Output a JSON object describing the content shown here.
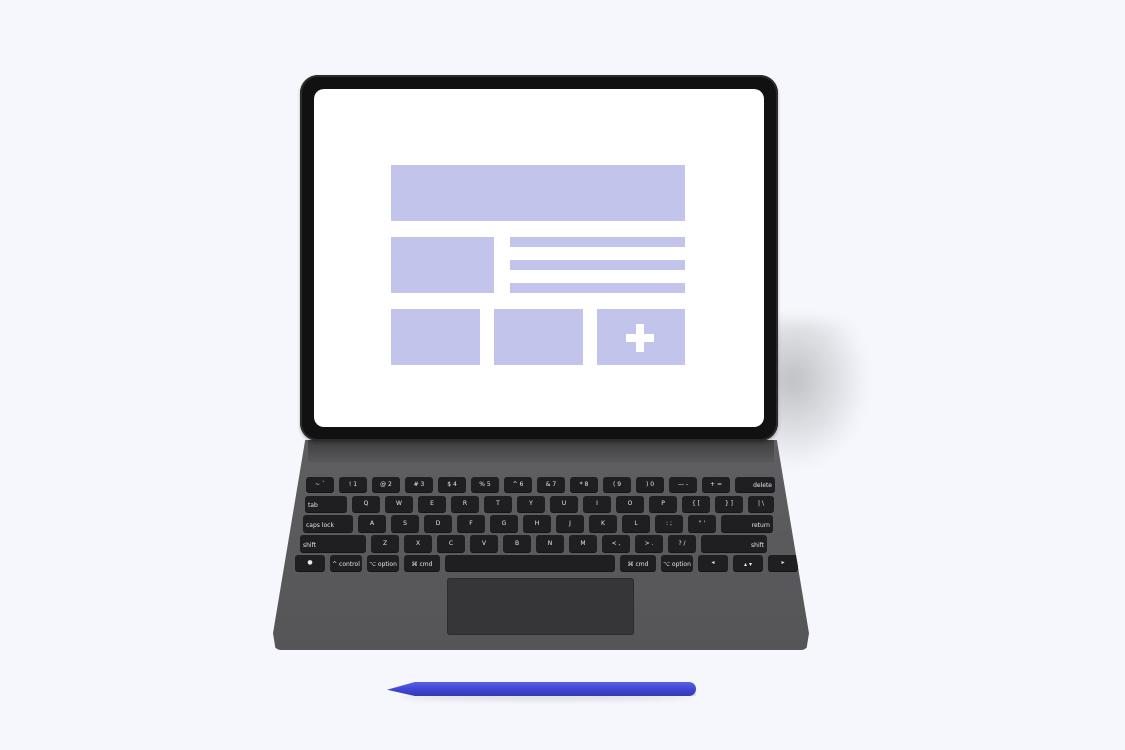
{
  "colors": {
    "background": "#f6f7fc",
    "wireframe": "#c3c4ec",
    "pencil": "#3f45d0",
    "keyboard": "#5a5a5c",
    "key": "#1f1f21"
  },
  "keyboard": {
    "row1": [
      "~ `",
      "! 1",
      "@ 2",
      "# 3",
      "$ 4",
      "% 5",
      "^ 6",
      "& 7",
      "* 8",
      "( 9",
      ") 0",
      "— -",
      "+ =",
      "delete"
    ],
    "row2": [
      "tab",
      "Q",
      "W",
      "E",
      "R",
      "T",
      "Y",
      "U",
      "I",
      "O",
      "P",
      "{ [",
      "} ]",
      "| \\"
    ],
    "row3": [
      "caps lock",
      "A",
      "S",
      "D",
      "F",
      "G",
      "H",
      "J",
      "K",
      "L",
      ": ;",
      "\" '",
      "return"
    ],
    "row4": [
      "shift",
      "Z",
      "X",
      "C",
      "V",
      "B",
      "N",
      "M",
      "< ,",
      "> .",
      "? /",
      "shift"
    ],
    "row5": [
      "●",
      "^ control",
      "⌥ option",
      "⌘ cmd",
      "",
      "⌘ cmd",
      "⌥ option",
      "◂",
      "▴ ▾",
      "▸"
    ]
  }
}
